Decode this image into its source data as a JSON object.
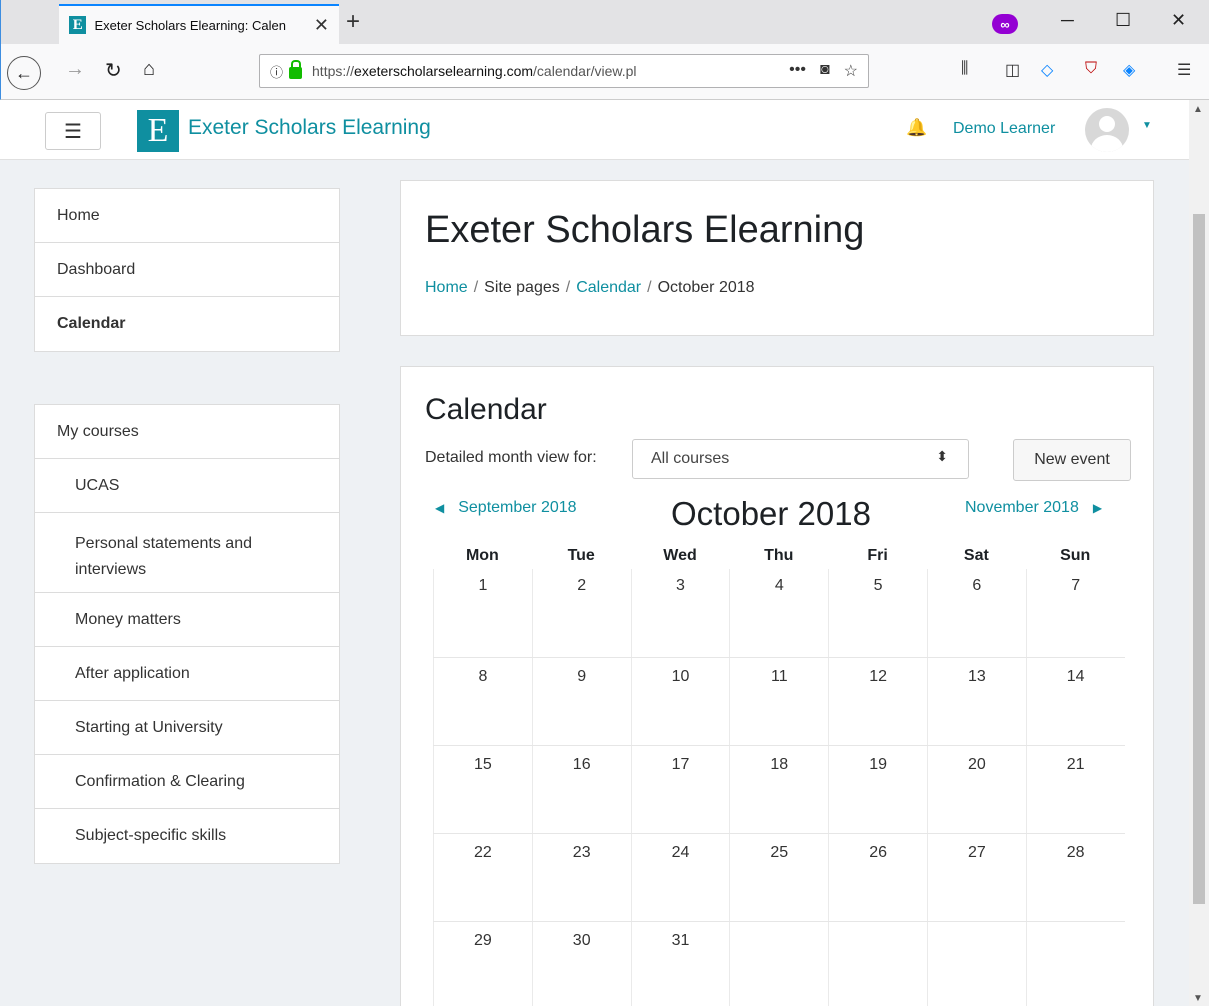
{
  "browser": {
    "tab_title": "Exeter Scholars Elearning: Calen",
    "tab_favicon": "E",
    "url_prefix": "https://",
    "url_host": "exeterscholarselearning.com",
    "url_path": "/calendar/view.pl",
    "min_label": "─",
    "max_label": "☐",
    "close_label": "✕"
  },
  "site": {
    "logo_letter": "E",
    "brand_name": "Exeter Scholars Elearning",
    "user_name": "Demo Learner",
    "accent_color": "#0f8fa0"
  },
  "sidebar": {
    "nav": [
      {
        "label": "Home"
      },
      {
        "label": "Dashboard"
      },
      {
        "label": "Calendar"
      }
    ],
    "courses_heading": "My courses",
    "courses": [
      {
        "label": "UCAS"
      },
      {
        "label": "Personal statements and interviews"
      },
      {
        "label": "Money matters"
      },
      {
        "label": "After application"
      },
      {
        "label": "Starting at University"
      },
      {
        "label": "Confirmation & Clearing"
      },
      {
        "label": "Subject-specific skills"
      }
    ]
  },
  "header": {
    "title": "Exeter Scholars Elearning",
    "breadcrumb": [
      "Home",
      "Site pages",
      "Calendar",
      "October 2018"
    ]
  },
  "calendar": {
    "title": "Calendar",
    "filter_label": "Detailed month view for:",
    "filter_value": "All courses",
    "new_event_label": "New event",
    "prev_month": "September 2018",
    "next_month": "November 2018",
    "current_month": "October 2018",
    "weekdays": [
      "Mon",
      "Tue",
      "Wed",
      "Thu",
      "Fri",
      "Sat",
      "Sun"
    ],
    "weeks": [
      [
        "1",
        "2",
        "3",
        "4",
        "5",
        "6",
        "7"
      ],
      [
        "8",
        "9",
        "10",
        "11",
        "12",
        "13",
        "14"
      ],
      [
        "15",
        "16",
        "17",
        "18",
        "19",
        "20",
        "21"
      ],
      [
        "22",
        "23",
        "24",
        "25",
        "26",
        "27",
        "28"
      ],
      [
        "29",
        "30",
        "31",
        "",
        "",
        "",
        ""
      ]
    ]
  }
}
